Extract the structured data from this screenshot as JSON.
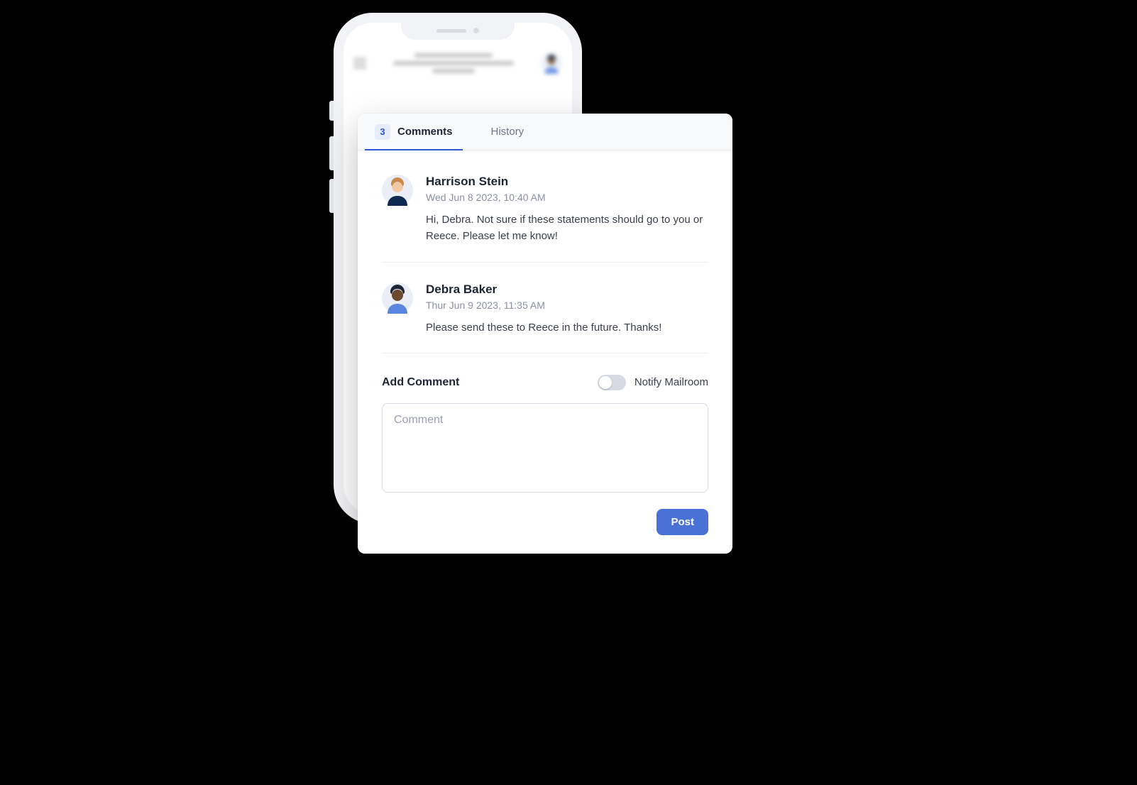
{
  "tabs": {
    "comments_count": "3",
    "comments_label": "Comments",
    "history_label": "History"
  },
  "comments": [
    {
      "author": "Harrison Stein",
      "timestamp": "Wed Jun 8 2023, 10:40 AM",
      "message": "Hi, Debra. Not sure if these statements should go to you or Reece. Please let me know!"
    },
    {
      "author": "Debra Baker",
      "timestamp": "Thur Jun 9 2023, 11:35 AM",
      "message": "Please send these to Reece in the future. Thanks!"
    }
  ],
  "add": {
    "title": "Add Comment",
    "notify_label": "Notify Mailroom",
    "placeholder": "Comment",
    "post_label": "Post"
  }
}
